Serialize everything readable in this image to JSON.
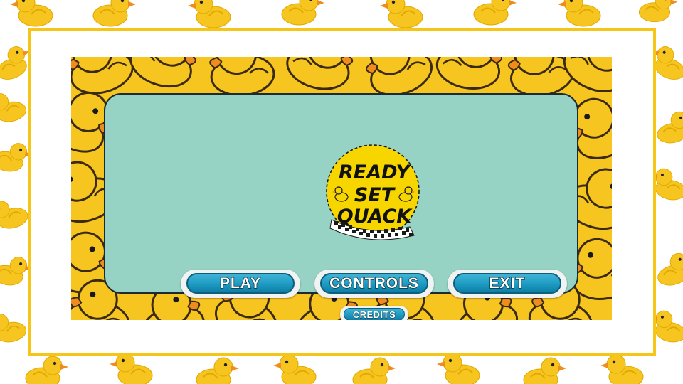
{
  "game": {
    "title_lines": [
      "READY",
      "SET",
      "QUACK"
    ]
  },
  "menu": {
    "play_label": "PLAY",
    "controls_label": "CONTROLS",
    "exit_label": "EXIT",
    "credits_label": "CREDITS"
  },
  "icons": {
    "background_pattern": "rubber-duck-icon",
    "logo_decoration": "duck-icon",
    "logo_flag": "checkered-flag-icon"
  },
  "colors": {
    "frame_border": "#f5c518",
    "duck_yellow": "#f7c51f",
    "duck_beak": "#f08c1e",
    "panel": "#96d3c4",
    "button": "#1b97bf"
  }
}
